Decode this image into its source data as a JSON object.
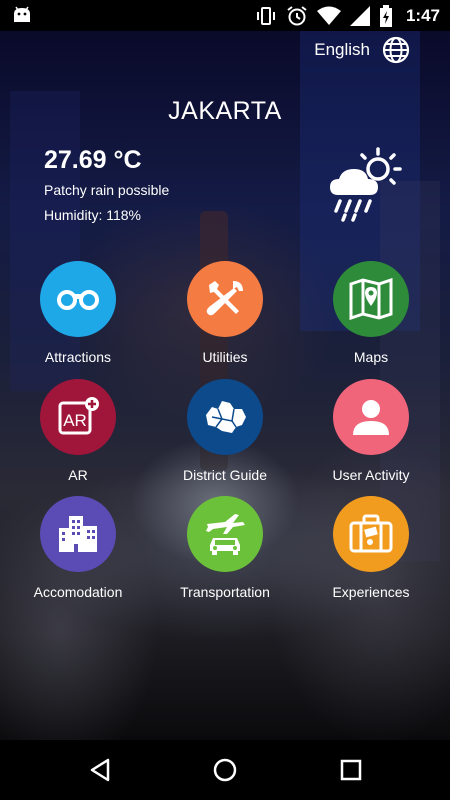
{
  "status_bar": {
    "time": "1:47",
    "icons": [
      "android-icon",
      "vibrate-icon",
      "alarm-icon",
      "wifi-icon",
      "signal-icon",
      "battery-charging-icon"
    ]
  },
  "header": {
    "language": "English",
    "language_icon": "globe-icon",
    "city": "JAKARTA"
  },
  "weather": {
    "temperature": "27.69 °C",
    "condition": "Patchy rain possible",
    "humidity": "Humidity: 118%",
    "icon": "rain-sun-cloud-icon"
  },
  "menu": [
    {
      "label": "Attractions",
      "icon": "binoculars-icon",
      "color": "#1ea8e8"
    },
    {
      "label": "Utilities",
      "icon": "tools-icon",
      "color": "#f47b42"
    },
    {
      "label": "Maps",
      "icon": "map-icon",
      "color": "#2e8b3a"
    },
    {
      "label": "AR",
      "icon": "ar-icon",
      "color": "#a0163a"
    },
    {
      "label": "District Guide",
      "icon": "district-map-icon",
      "color": "#0d4a8c"
    },
    {
      "label": "User Activity",
      "icon": "user-icon",
      "color": "#f0657a"
    },
    {
      "label": "Accomodation",
      "icon": "building-icon",
      "color": "#5b4bb5"
    },
    {
      "label": "Transportation",
      "icon": "transport-icon",
      "color": "#6cc13a"
    },
    {
      "label": "Experiences",
      "icon": "suitcase-icon",
      "color": "#f29c1f"
    }
  ],
  "nav": {
    "buttons": [
      "back-icon",
      "home-icon",
      "recents-icon"
    ]
  }
}
